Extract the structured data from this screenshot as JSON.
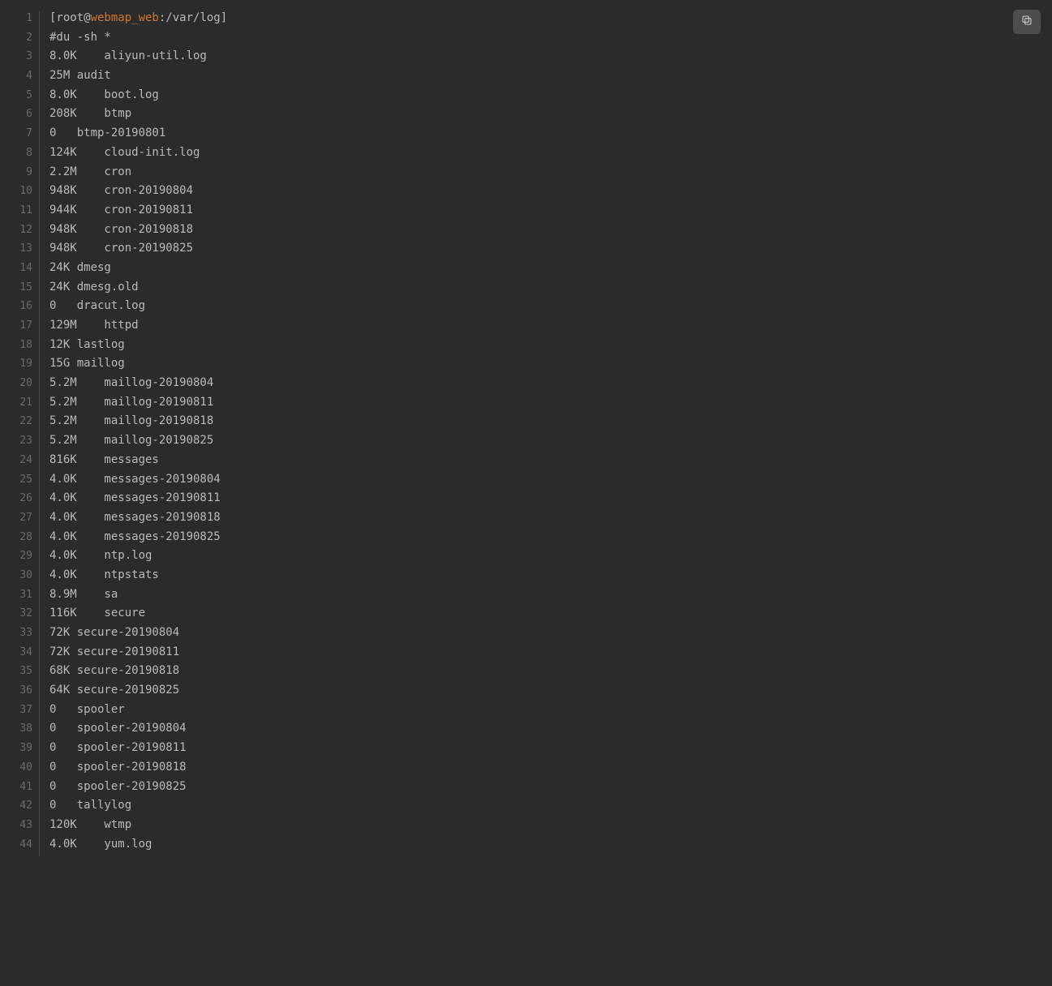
{
  "prompt": {
    "prefix": "[root@",
    "host": "webmap_web",
    "suffix": ":/var/log]"
  },
  "command": "#du -sh *",
  "entries": [
    {
      "size": "8.0K",
      "gap": "    ",
      "name": "aliyun-util.log"
    },
    {
      "size": "25M",
      "gap": " ",
      "name": "audit"
    },
    {
      "size": "8.0K",
      "gap": "    ",
      "name": "boot.log"
    },
    {
      "size": "208K",
      "gap": "    ",
      "name": "btmp"
    },
    {
      "size": "0",
      "gap": "   ",
      "name": "btmp-20190801"
    },
    {
      "size": "124K",
      "gap": "    ",
      "name": "cloud-init.log"
    },
    {
      "size": "2.2M",
      "gap": "    ",
      "name": "cron"
    },
    {
      "size": "948K",
      "gap": "    ",
      "name": "cron-20190804"
    },
    {
      "size": "944K",
      "gap": "    ",
      "name": "cron-20190811"
    },
    {
      "size": "948K",
      "gap": "    ",
      "name": "cron-20190818"
    },
    {
      "size": "948K",
      "gap": "    ",
      "name": "cron-20190825"
    },
    {
      "size": "24K",
      "gap": " ",
      "name": "dmesg"
    },
    {
      "size": "24K",
      "gap": " ",
      "name": "dmesg.old"
    },
    {
      "size": "0",
      "gap": "   ",
      "name": "dracut.log"
    },
    {
      "size": "129M",
      "gap": "    ",
      "name": "httpd"
    },
    {
      "size": "12K",
      "gap": " ",
      "name": "lastlog"
    },
    {
      "size": "15G",
      "gap": " ",
      "name": "maillog"
    },
    {
      "size": "5.2M",
      "gap": "    ",
      "name": "maillog-20190804"
    },
    {
      "size": "5.2M",
      "gap": "    ",
      "name": "maillog-20190811"
    },
    {
      "size": "5.2M",
      "gap": "    ",
      "name": "maillog-20190818"
    },
    {
      "size": "5.2M",
      "gap": "    ",
      "name": "maillog-20190825"
    },
    {
      "size": "816K",
      "gap": "    ",
      "name": "messages"
    },
    {
      "size": "4.0K",
      "gap": "    ",
      "name": "messages-20190804"
    },
    {
      "size": "4.0K",
      "gap": "    ",
      "name": "messages-20190811"
    },
    {
      "size": "4.0K",
      "gap": "    ",
      "name": "messages-20190818"
    },
    {
      "size": "4.0K",
      "gap": "    ",
      "name": "messages-20190825"
    },
    {
      "size": "4.0K",
      "gap": "    ",
      "name": "ntp.log"
    },
    {
      "size": "4.0K",
      "gap": "    ",
      "name": "ntpstats"
    },
    {
      "size": "8.9M",
      "gap": "    ",
      "name": "sa"
    },
    {
      "size": "116K",
      "gap": "    ",
      "name": "secure"
    },
    {
      "size": "72K",
      "gap": " ",
      "name": "secure-20190804"
    },
    {
      "size": "72K",
      "gap": " ",
      "name": "secure-20190811"
    },
    {
      "size": "68K",
      "gap": " ",
      "name": "secure-20190818"
    },
    {
      "size": "64K",
      "gap": " ",
      "name": "secure-20190825"
    },
    {
      "size": "0",
      "gap": "   ",
      "name": "spooler"
    },
    {
      "size": "0",
      "gap": "   ",
      "name": "spooler-20190804"
    },
    {
      "size": "0",
      "gap": "   ",
      "name": "spooler-20190811"
    },
    {
      "size": "0",
      "gap": "   ",
      "name": "spooler-20190818"
    },
    {
      "size": "0",
      "gap": "   ",
      "name": "spooler-20190825"
    },
    {
      "size": "0",
      "gap": "   ",
      "name": "tallylog"
    },
    {
      "size": "120K",
      "gap": "    ",
      "name": "wtmp"
    },
    {
      "size": "4.0K",
      "gap": "    ",
      "name": "yum.log"
    }
  ],
  "icons": {
    "copy": "copy-icon"
  }
}
